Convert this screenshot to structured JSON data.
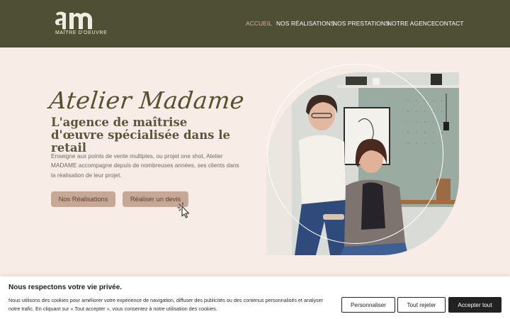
{
  "logo": {
    "text": "MAÎTRE D'OEUVRE"
  },
  "nav": {
    "items": [
      {
        "label": "ACCUEIL",
        "active": true
      },
      {
        "label": "NOS RÉALISATIONS",
        "active": false
      },
      {
        "label": "NOS PRESTATIONS",
        "active": false
      },
      {
        "label": "NOTRE AGENCE",
        "active": false
      },
      {
        "label": "CONTACT",
        "active": false
      }
    ]
  },
  "hero": {
    "script_title": "Atelier Madame",
    "subtitle": "L'agence de maîtrise d'œuvre spécialisée dans le retail",
    "paragraph": "Enseigne aux points de vente multiples, ou projet one shot, Atelier MADAME accompagne depuis de nombreuses années, ses clients dans la réalisation de leur projet.",
    "buttons": [
      "Nos Réalisations",
      "Réaliser un devis"
    ]
  },
  "cookie": {
    "title": "Nous respectons votre vie privée.",
    "text": "Nous utilisons des cookies pour améliorer votre expérience de navigation, diffuser des publicités ou des contenus personnalisés et analyser notre trafic. En cliquant sur « Tout accepter », vous consentez à notre utilisation des cookies.",
    "buttons": {
      "customize": "Personnaliser",
      "reject": "Tout rejeter",
      "accept": "Accepter tout"
    }
  },
  "colors": {
    "header_bg": "#4e4f34",
    "page_bg": "#f8ece6",
    "button_bg": "#c7a795",
    "active_nav": "#d7b7a5",
    "title": "#55512f",
    "accept_bg": "#222222"
  }
}
